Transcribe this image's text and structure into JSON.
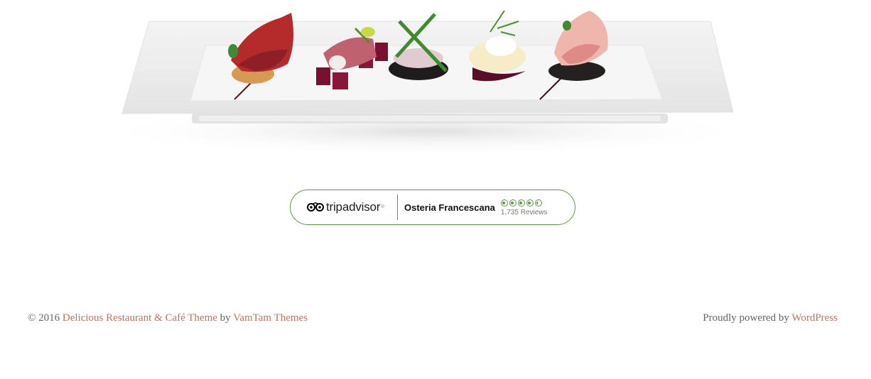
{
  "colors": {
    "accent": "#c07257",
    "tripadvisor_green": "#5b9a3b",
    "footer_text": "#666666"
  },
  "hero": {
    "icon": "canape-plate-image"
  },
  "tripadvisor": {
    "logo_text_a": "trip",
    "logo_text_b": "advisor",
    "logo_mark": "®",
    "restaurant_name": "Osteria Francescana",
    "rating": 4.5,
    "rating_max": 5,
    "reviews": "1,735 Reviews"
  },
  "footer": {
    "copyright": "© 2016",
    "theme_link": "Delicious Restaurant & Café Theme",
    "by": "by",
    "author_link": "VamTam Themes",
    "powered_by": "Proudly powered by",
    "wordpress_link": "WordPress"
  }
}
